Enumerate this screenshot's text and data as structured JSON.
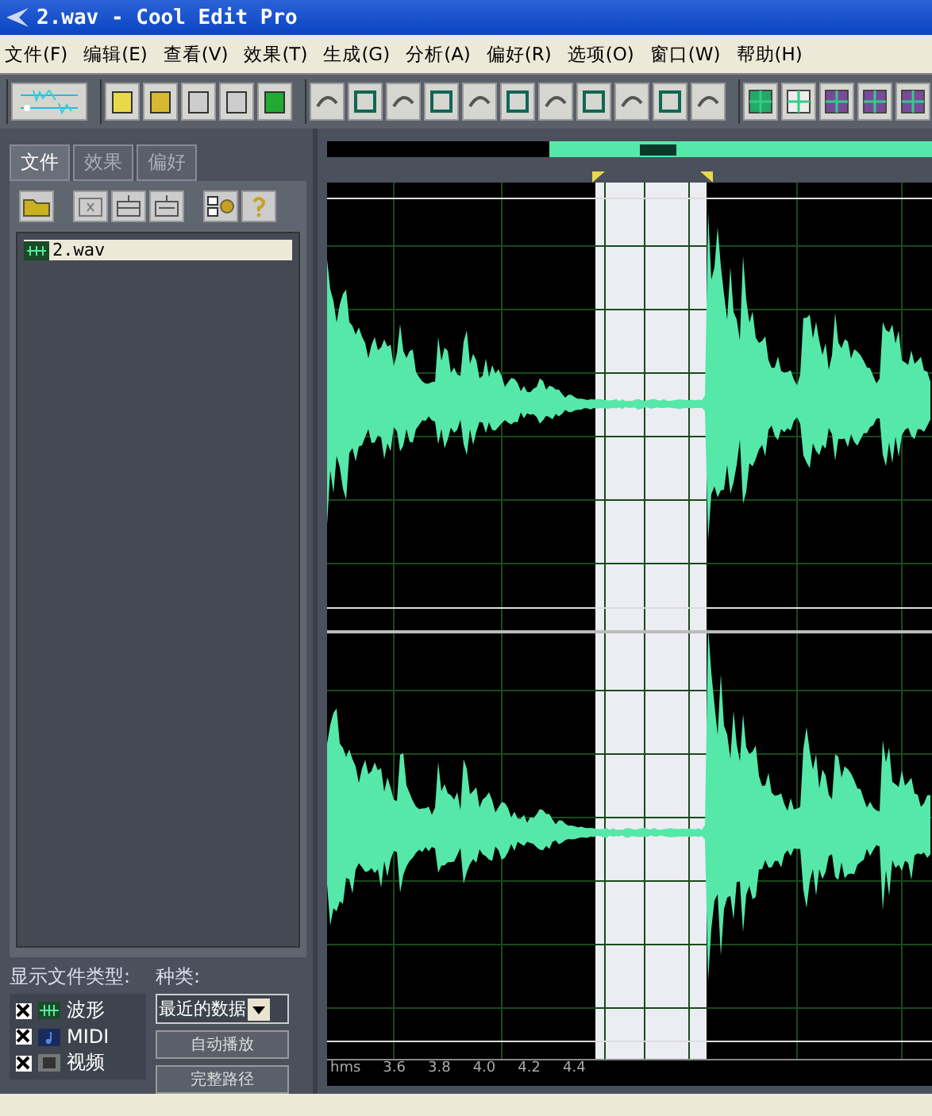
{
  "window": {
    "title": "2.wav - Cool Edit Pro"
  },
  "menu": [
    "文件(F)",
    "编辑(E)",
    "查看(V)",
    "效果(T)",
    "生成(G)",
    "分析(A)",
    "偏好(R)",
    "选项(O)",
    "窗口(W)",
    "帮助(H)"
  ],
  "panel_tabs": [
    {
      "label": "文件",
      "selected": true
    },
    {
      "label": "效果",
      "selected": false
    },
    {
      "label": "偏好",
      "selected": false
    }
  ],
  "files": [
    {
      "name": "2.wav",
      "selected": true
    }
  ],
  "filter": {
    "label": "显示文件类型:",
    "types": [
      {
        "label": "波形",
        "checked": true,
        "kind": "wave"
      },
      {
        "label": "MIDI",
        "checked": true,
        "kind": "midi"
      },
      {
        "label": "视频",
        "checked": true,
        "kind": "video"
      }
    ]
  },
  "sort": {
    "label": "种类:",
    "value": "最近的数据"
  },
  "buttons": [
    "自动播放",
    "完整路径"
  ],
  "ruler": {
    "labels": [
      "hms",
      "3.6",
      "3.8",
      "4.0",
      "4.2",
      "4.4"
    ]
  }
}
